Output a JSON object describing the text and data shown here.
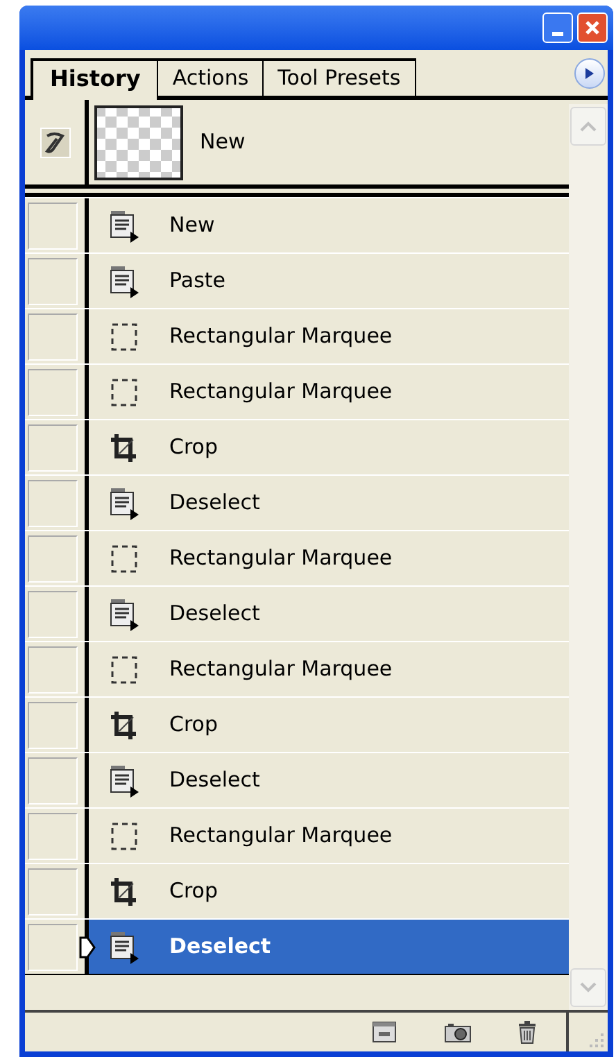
{
  "tabs": [
    {
      "label": "History",
      "selected": true
    },
    {
      "label": "Actions",
      "selected": false
    },
    {
      "label": "Tool Presets",
      "selected": false
    }
  ],
  "snapshot": {
    "label": "New"
  },
  "history": [
    {
      "label": "New",
      "kind": "document",
      "selected": false
    },
    {
      "label": "Paste",
      "kind": "document",
      "selected": false
    },
    {
      "label": "Rectangular Marquee",
      "kind": "marquee",
      "selected": false
    },
    {
      "label": "Rectangular Marquee",
      "kind": "marquee",
      "selected": false
    },
    {
      "label": "Crop",
      "kind": "crop",
      "selected": false
    },
    {
      "label": "Deselect",
      "kind": "document",
      "selected": false
    },
    {
      "label": "Rectangular Marquee",
      "kind": "marquee",
      "selected": false
    },
    {
      "label": "Deselect",
      "kind": "document",
      "selected": false
    },
    {
      "label": "Rectangular Marquee",
      "kind": "marquee",
      "selected": false
    },
    {
      "label": "Crop",
      "kind": "crop",
      "selected": false
    },
    {
      "label": "Deselect",
      "kind": "document",
      "selected": false
    },
    {
      "label": "Rectangular Marquee",
      "kind": "marquee",
      "selected": false
    },
    {
      "label": "Crop",
      "kind": "crop",
      "selected": false
    },
    {
      "label": "Deselect",
      "kind": "document",
      "selected": true
    }
  ]
}
